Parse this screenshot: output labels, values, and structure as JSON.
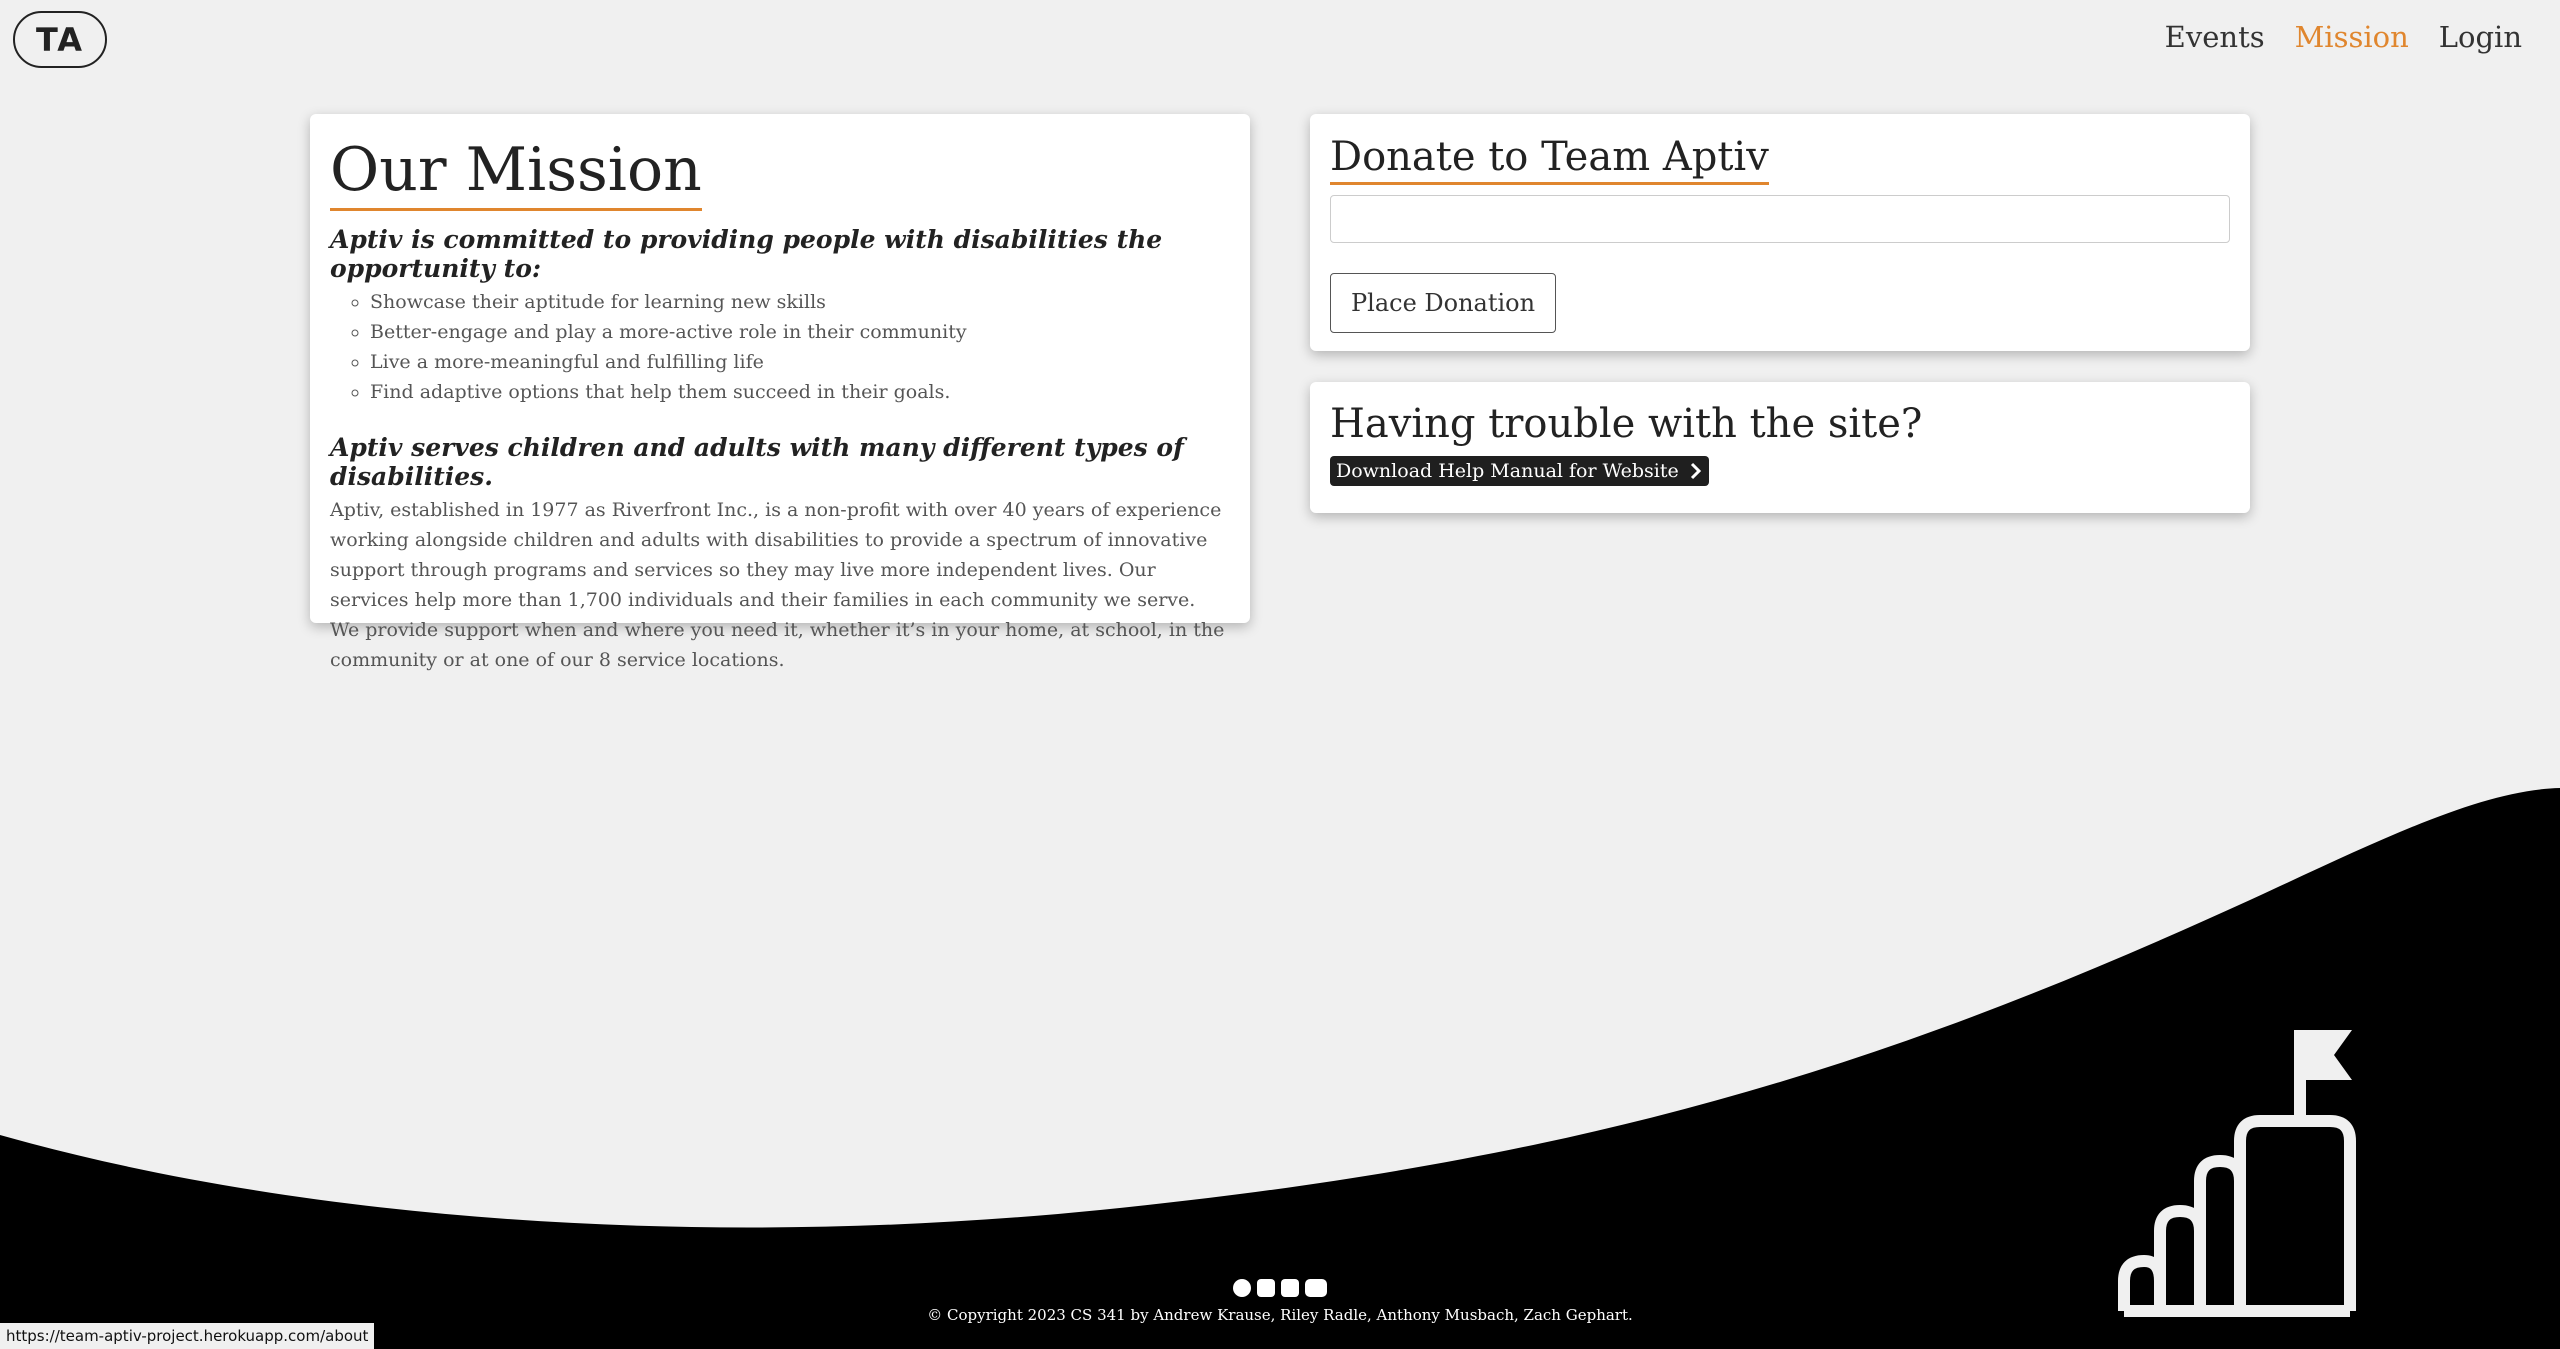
{
  "header": {
    "logo": "TA",
    "nav": [
      {
        "label": "Events",
        "active": false
      },
      {
        "label": "Mission",
        "active": true
      },
      {
        "label": "Login",
        "active": false
      }
    ]
  },
  "mission": {
    "title": "Our Mission",
    "intro_heading": "Aptiv is committed to providing people with disabilities the opportunity to:",
    "bullets": [
      "Showcase their aptitude for learning new skills",
      "Better-engage and play a more-active role in their community",
      "Live a more-meaningful and fulfilling life",
      "Find adaptive options that help them succeed in their goals."
    ],
    "second_heading": "Aptiv serves children and adults with many different types of disabilities.",
    "body": "Aptiv, established in 1977 as Riverfront Inc., is a non-profit with over 40 years of experience working alongside children and adults with disabilities to provide a spectrum of innovative support through programs and services so they may live more independent lives. Our services help more than 1,700 individuals and their families in each community we serve. We provide support when and where you need it, whether it’s in your home, at school, in the community or at one of our 8 service locations."
  },
  "donate": {
    "title": "Donate to Team Aptiv",
    "input_value": "",
    "button_label": "Place Donation"
  },
  "help": {
    "title": "Having trouble with the site?",
    "download_label": "Download Help Manual for Website"
  },
  "footer": {
    "social_icons": [
      "facebook-icon",
      "instagram-icon",
      "linkedin-icon",
      "youtube-icon"
    ],
    "copyright": "© Copyright 2023 CS 341 by Andrew Krause, Riley Radle, Anthony Musbach, Zach Gephart."
  },
  "status_bar": {
    "url": "https://team-aptiv-project.herokuapp.com/about"
  },
  "colors": {
    "accent": "#e0862e",
    "background": "#f0f0f0",
    "footer": "#000000"
  }
}
